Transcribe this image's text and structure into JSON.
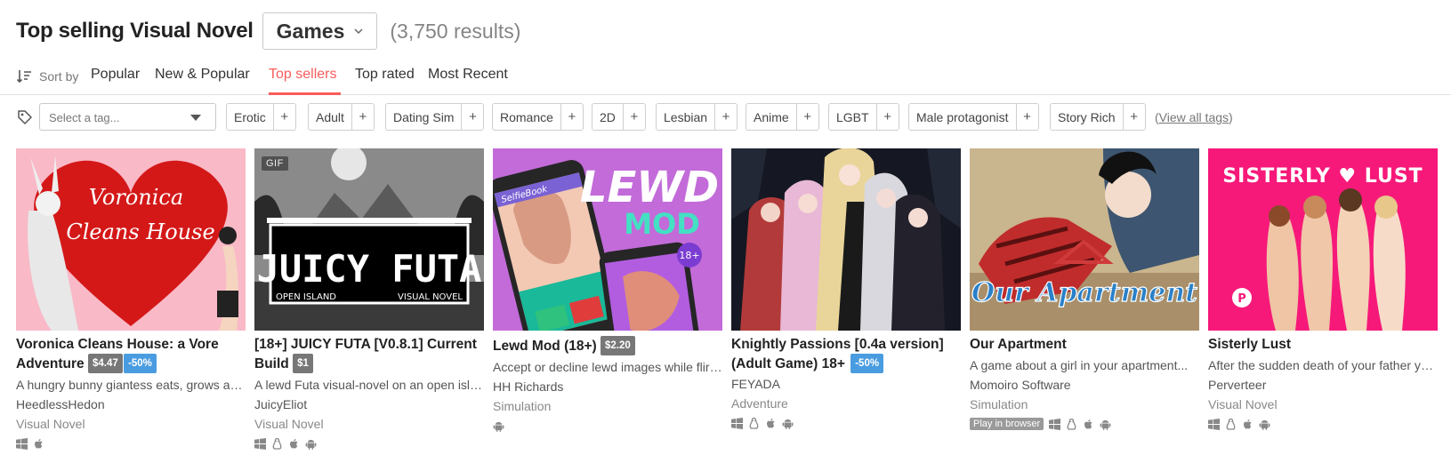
{
  "header": {
    "title": "Top selling Visual Novel",
    "type_label": "Games",
    "result_count": "(3,750 results)"
  },
  "sort": {
    "label": "Sort by",
    "tabs": [
      {
        "label": "Popular",
        "active": false
      },
      {
        "label": "New & Popular",
        "active": false
      },
      {
        "label": "Top sellers",
        "active": true
      },
      {
        "label": "Top rated",
        "active": false
      },
      {
        "label": "Most Recent",
        "active": false
      }
    ]
  },
  "tags": {
    "placeholder": "Select a tag...",
    "items": [
      "Erotic",
      "Adult",
      "Dating Sim",
      "Romance",
      "2D",
      "Lesbian",
      "Anime",
      "LGBT",
      "Male protagonist",
      "Story Rich"
    ],
    "add_symbol": "+",
    "view_all": "View all tags",
    "view_all_prefix": "(",
    "view_all_suffix": ")"
  },
  "colors": {
    "accent": "#fa5c5c",
    "sale": "#4a9ce0",
    "price": "#777777"
  },
  "games": [
    {
      "title_line1": "Voronica Cleans House: a Vore",
      "title_line2": "Adventure",
      "price": "$4.47",
      "sale": "-50%",
      "description": "A hungry bunny giantess eats, grows and...",
      "author": "HeedlessHedon",
      "genre": "Visual Novel",
      "cover_text_1": "Voronica",
      "cover_text_2": "Cleans House",
      "platforms": [
        "windows-icon",
        "apple-icon"
      ]
    },
    {
      "title_line1": "[18+] JUICY FUTA [V0.8.1] Current",
      "title_line2": "Build",
      "price": "$1",
      "description": "A lewd Futa visual-novel on an open isla...",
      "author": "JuicyEliot",
      "genre": "Visual Novel",
      "gif_badge": "GIF",
      "cover_text_1": "JUICY FUTA",
      "cover_text_2": "OPEN ISLAND",
      "cover_text_3": "VISUAL NOVEL",
      "platforms": [
        "windows-icon",
        "linux-icon",
        "apple-icon",
        "android-icon"
      ]
    },
    {
      "title_line1": "Lewd Mod (18+)",
      "price": "$2.20",
      "description": "Accept or decline lewd images while flirt...",
      "author": "HH Richards",
      "genre": "Simulation",
      "cover_text_1": "LEWD",
      "cover_text_2": "MOD",
      "cover_text_3": "18+",
      "cover_text_4": "SelfieBook",
      "platforms": [
        "android-icon"
      ]
    },
    {
      "title_line1": "Knightly Passions [0.4a version]",
      "title_line2": "(Adult Game) 18+",
      "sale": "-50%",
      "author": "FEYADA",
      "genre": "Adventure",
      "platforms": [
        "windows-icon",
        "linux-icon",
        "apple-icon",
        "android-icon"
      ]
    },
    {
      "title_line1": "Our Apartment",
      "description": "A game about a girl in your apartment...",
      "author": "Momoiro Software",
      "genre": "Simulation",
      "cover_text_1": "Our Apartment",
      "browser_badge": "Play in browser",
      "platforms": [
        "windows-icon",
        "linux-icon",
        "apple-icon",
        "android-icon"
      ]
    },
    {
      "title_line1": "Sisterly Lust",
      "description": "After the sudden death of your father yo...",
      "author": "Perverteer",
      "genre": "Visual Novel",
      "cover_text_1": "SISTERLY ♥ LUST",
      "cover_text_2": "P",
      "platforms": [
        "windows-icon",
        "linux-icon",
        "apple-icon",
        "android-icon"
      ]
    }
  ]
}
